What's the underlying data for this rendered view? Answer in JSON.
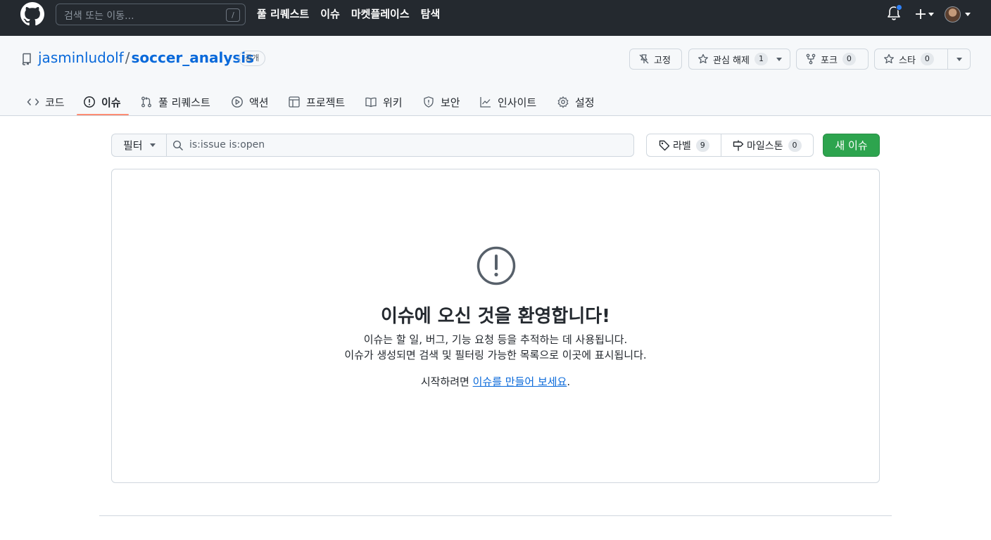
{
  "topbar": {
    "search_placeholder": "검색 또는 이동...",
    "search_shortcut": "/",
    "nav": [
      "풀 리퀘스트",
      "이슈",
      "마켓플레이스",
      "탐색"
    ]
  },
  "repo": {
    "owner": "jasminludolf",
    "separator": "/",
    "name": "soccer_analysis",
    "visibility": "공개",
    "pin_label": "고정",
    "watch_label": "관심 해제",
    "watch_count": "1",
    "fork_label": "포크",
    "fork_count": "0",
    "star_label": "스타",
    "star_count": "0"
  },
  "tabs": [
    {
      "label": "코드",
      "icon": "code-icon"
    },
    {
      "label": "이슈",
      "icon": "issue-opened-icon",
      "active": true
    },
    {
      "label": "풀 리퀘스트",
      "icon": "git-pull-request-icon"
    },
    {
      "label": "액션",
      "icon": "play-icon"
    },
    {
      "label": "프로젝트",
      "icon": "table-icon"
    },
    {
      "label": "위키",
      "icon": "book-icon"
    },
    {
      "label": "보안",
      "icon": "shield-icon"
    },
    {
      "label": "인사이트",
      "icon": "graph-icon"
    },
    {
      "label": "설정",
      "icon": "gear-icon"
    }
  ],
  "filters": {
    "filter_label": "필터",
    "query": "is:issue is:open",
    "labels_label": "라벨",
    "labels_count": "9",
    "milestones_label": "마일스톤",
    "milestones_count": "0",
    "new_issue_label": "새 이슈"
  },
  "blankslate": {
    "title": "이슈에 오신 것을 환영합니다!",
    "line1": "이슈는 할 일, 버그, 기능 요청 등을 추적하는 데 사용됩니다.",
    "line2": "이슈가 생성되면 검색 및 필터링 가능한 목록으로 이곳에 표시됩니다.",
    "cta_prefix": "시작하려면 ",
    "cta_link": "이슈를 만들어 보세요",
    "cta_suffix": "."
  },
  "colors": {
    "header_bg": "#24292f",
    "link": "#0969da",
    "primary_button": "#2da44e",
    "active_tab_underline": "#fd8c73",
    "notification_dot": "#2f81f7"
  }
}
